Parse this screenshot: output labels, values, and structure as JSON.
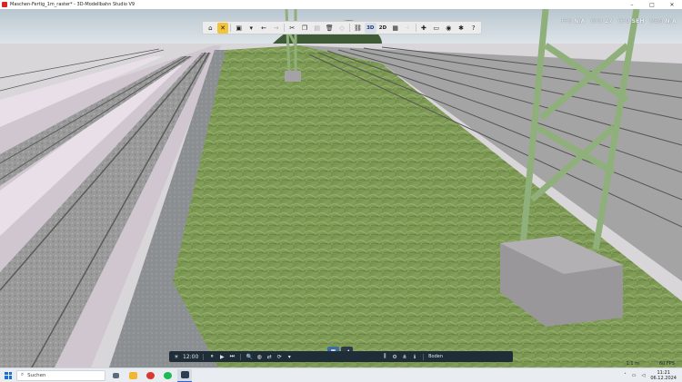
{
  "window": {
    "title": "Maschen-Fertig_1m_raster* - 3D-Modellbahn Studio V9",
    "minimize": "–",
    "maximize": "□",
    "close": "✕"
  },
  "toolbar": {
    "buttons": [
      {
        "name": "home-icon",
        "glyph": "⌂"
      },
      {
        "name": "tools-icon",
        "glyph": "✕",
        "active": true
      },
      {
        "name": "save-icon",
        "glyph": "▣"
      },
      {
        "name": "save-dropdown-icon",
        "glyph": "▾"
      },
      {
        "name": "undo-icon",
        "glyph": "←"
      },
      {
        "name": "redo-icon",
        "glyph": "→",
        "dim": true
      },
      {
        "name": "cut-icon",
        "glyph": "✂"
      },
      {
        "name": "copy-icon",
        "glyph": "❐"
      },
      {
        "name": "paste-icon",
        "glyph": "▤",
        "dim": true
      },
      {
        "name": "delete-icon",
        "glyph": "🗑"
      },
      {
        "name": "layer-icon",
        "glyph": "◇",
        "dim": true
      },
      {
        "name": "link-icon",
        "glyph": "⛓"
      },
      {
        "name": "grid-icon",
        "glyph": "▦"
      },
      {
        "name": "snap-icon",
        "glyph": "⁘",
        "dim": true
      },
      {
        "name": "add-icon",
        "glyph": "✚"
      },
      {
        "name": "view-icon",
        "glyph": "▭"
      },
      {
        "name": "camera-icon",
        "glyph": "◉"
      },
      {
        "name": "plugin-icon",
        "glyph": "✱"
      },
      {
        "name": "help-icon",
        "glyph": "?"
      }
    ],
    "mode_3d": "3D",
    "mode_2d": "2D"
  },
  "hud": {
    "fps_label": "FPS",
    "fps_value": "N/A",
    "gpu_label": "GPU",
    "gpu_value": "27",
    "cpu_label": "CPU",
    "cpu_value": "SEH",
    "mem_label": "MEM",
    "mem_value": "N/A"
  },
  "controlbar": {
    "sun_icon": "☀",
    "time": "12:00",
    "pause": "⏸",
    "play": "▶",
    "skip": "⏭",
    "zoom_icon": "🔍",
    "globe_icon": "◍",
    "shuffle_icon": "⇄",
    "dropdown": "▾",
    "speed_icon": "⟳",
    "sliders_icon": "⫼",
    "gear_icon": "⚙",
    "tree_icon": "⋔",
    "info_icon": "ℹ",
    "layer_label": "Boden"
  },
  "status": {
    "scale": "1:1 m",
    "fps": "60 FPS"
  },
  "taskbar": {
    "search_placeholder": "Suchen",
    "time": "11:21",
    "date": "06.12.2024"
  }
}
